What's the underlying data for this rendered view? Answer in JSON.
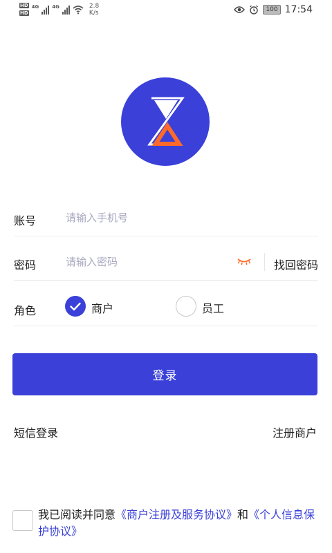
{
  "status_bar": {
    "hd1": "HD",
    "hd2": "HD",
    "net1": "4G",
    "net2": "4G",
    "speed_value": "2.8",
    "speed_unit": "K/s",
    "battery": "100",
    "time": "17:54"
  },
  "form": {
    "account_label": "账号",
    "account_placeholder": "请输入手机号",
    "password_label": "密码",
    "password_placeholder": "请输入密码",
    "forgot_password": "找回密码",
    "role_label": "角色",
    "role_options": [
      {
        "label": "商户",
        "selected": true
      },
      {
        "label": "员工",
        "selected": false
      }
    ]
  },
  "actions": {
    "login": "登录",
    "sms_login": "短信登录",
    "register_merchant": "注册商户"
  },
  "agreement": {
    "prefix": "我已阅读并同意",
    "service_agreement": "《商户注册及服务协议》",
    "conjunction": "和",
    "privacy_agreement": "《个人信息保护协议》",
    "checked": false
  },
  "colors": {
    "primary": "#3a40d8",
    "accent_orange": "#ff6a2a",
    "placeholder": "#a8a8c0"
  }
}
